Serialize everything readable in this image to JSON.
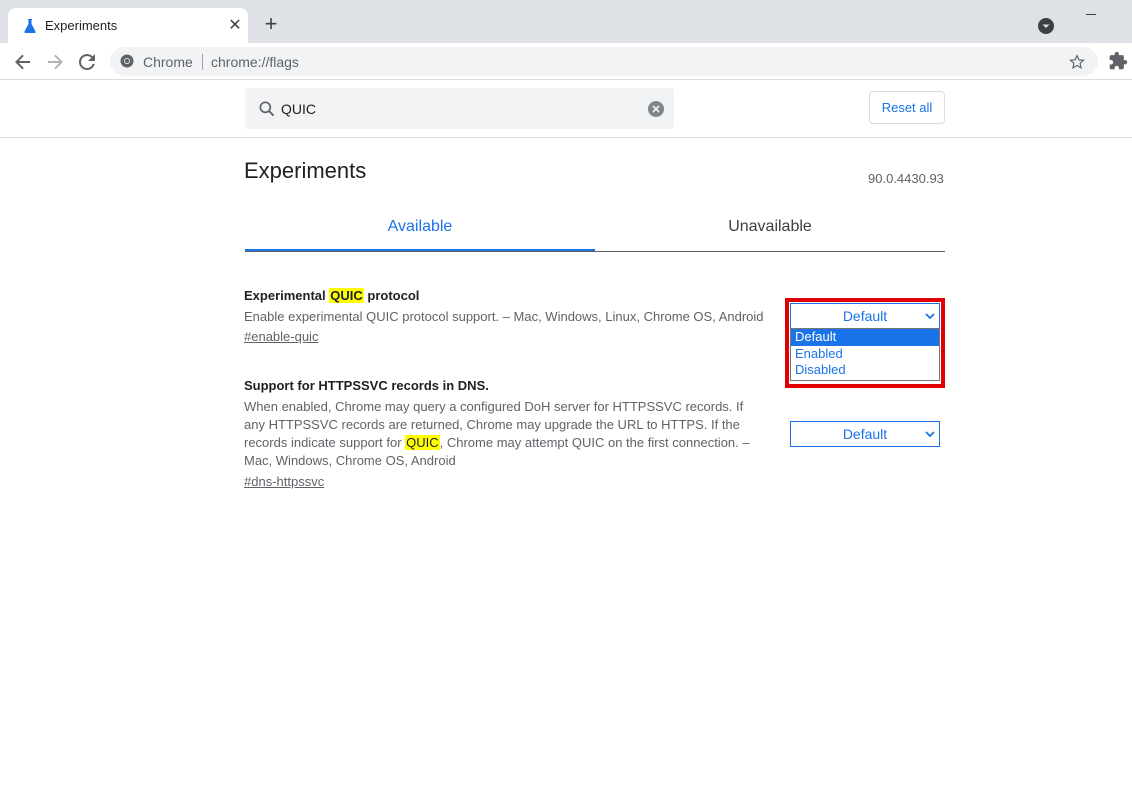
{
  "browser": {
    "tab_title": "Experiments",
    "omnibox_scheme": "Chrome",
    "omnibox_url": "chrome://flags"
  },
  "search": {
    "value": "QUIC",
    "reset_label": "Reset all"
  },
  "page": {
    "title": "Experiments",
    "version": "90.0.4430.93",
    "tabs": [
      "Available",
      "Unavailable"
    ]
  },
  "flags": [
    {
      "title_pre": "Experimental ",
      "title_mark": "QUIC",
      "title_post": " protocol",
      "description": "Enable experimental QUIC protocol support. – Mac, Windows, Linux, Chrome OS, Android",
      "link": "#enable-quic",
      "selected": "Default"
    },
    {
      "title": "Support for HTTPSSVC records in DNS.",
      "desc_pre": "When enabled, Chrome may query a configured DoH server for HTTPSSVC records. If any HTTPSSVC records are returned, Chrome may upgrade the URL to HTTPS. If the records indicate support for ",
      "desc_mark": "QUIC",
      "desc_post": ", Chrome may attempt QUIC on the first connection. – Mac, Windows, Chrome OS, Android",
      "link": "#dns-httpssvc",
      "selected": "Default"
    }
  ],
  "dropdown_options": [
    "Default",
    "Enabled",
    "Disabled"
  ],
  "colors": {
    "accent": "#1a73e8",
    "highlight_box": "#e00000",
    "search_mark": "#ffff00"
  }
}
